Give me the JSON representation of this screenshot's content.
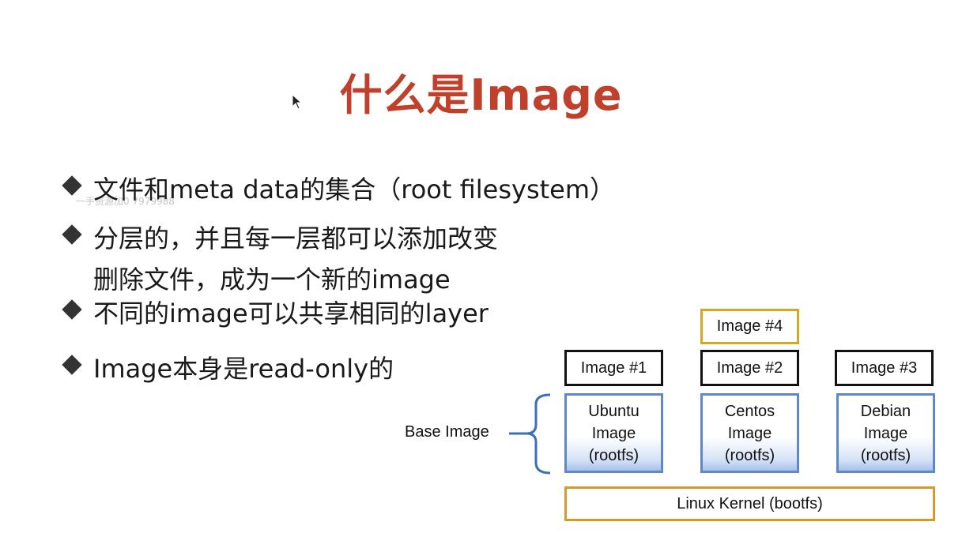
{
  "title": "什么是Image",
  "watermark": "一手资源加0 7979988",
  "bullets": [
    {
      "lines": [
        "文件和meta data的集合（root filesystem）"
      ]
    },
    {
      "lines": [
        "分层的，并且每一层都可以添加改变",
        "删除文件，成为一个新的image"
      ]
    },
    {
      "lines": [
        "不同的image可以共享相同的layer"
      ]
    },
    {
      "lines": [
        "Image本身是read-only的"
      ]
    }
  ],
  "diagram": {
    "image4": "Image #4",
    "image1": "Image #1",
    "image2": "Image #2",
    "image3": "Image #3",
    "base_label": "Base Image",
    "ubuntu": [
      "Ubuntu",
      "Image",
      "(rootfs)"
    ],
    "centos": [
      "Centos",
      "Image",
      "(rootfs)"
    ],
    "debian": [
      "Debian",
      "Image",
      "(rootfs)"
    ],
    "kernel": "Linux Kernel (bootfs)"
  },
  "colors": {
    "title": "#c0402b",
    "image4_border": "#d6a820",
    "base_border": "#5e88c8",
    "kernel_border": "#d49a2a"
  }
}
